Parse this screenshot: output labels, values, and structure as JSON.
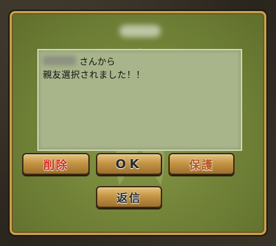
{
  "dialog": {
    "message_line1": "さんから",
    "message_line2": "親友選択されました！！"
  },
  "buttons": {
    "delete_label": "削除",
    "ok_label": "OK",
    "protect_label": "保護",
    "reply_label": "返信"
  },
  "colors": {
    "panel_green": "#75863a",
    "frame_gold": "#c9a24a",
    "button_gold": "#c49545",
    "delete_red": "#d32a1e",
    "protect_orange": "#b4541a"
  }
}
